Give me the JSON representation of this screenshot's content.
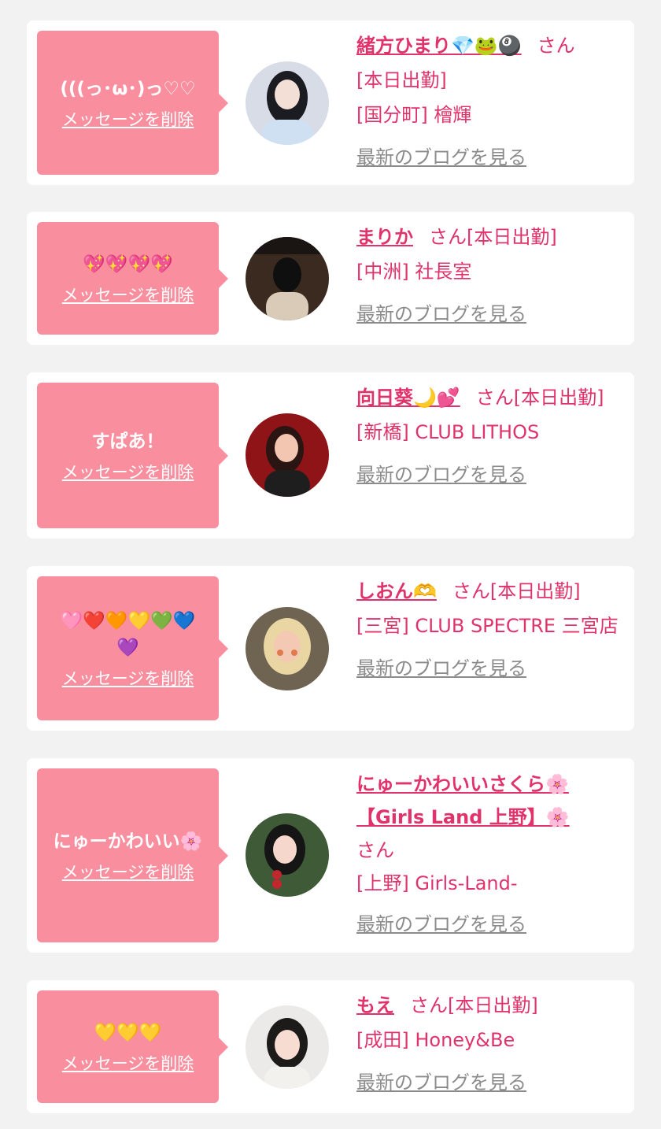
{
  "items": [
    {
      "message": "(((っ･ω･)っ♡♡",
      "delete_label": "メッセージを削除",
      "name": "緒方ひまり💎🐸🎱",
      "san": "さん",
      "status": "[本日出勤]",
      "area": "[国分町] 檜輝",
      "blog_label": "最新のブログを見る",
      "avatar_colors": [
        "#d8dce6",
        "#1b1b22",
        "#cfe0f3"
      ]
    },
    {
      "message": "💖💖💖💖",
      "delete_label": "メッセージを削除",
      "name": "まりか",
      "san": "さん",
      "status": "[本日出勤]",
      "area": "[中洲] 社長室",
      "blog_label": "最新のブログを見る",
      "avatar_colors": [
        "#3a2a20",
        "#0f0f10",
        "#d9cbb8"
      ]
    },
    {
      "message": "すぱあ！",
      "delete_label": "メッセージを削除",
      "name": "向日葵🌙💕",
      "san": "さん",
      "status": "[本日出勤]",
      "area": "[新橋] CLUB LITHOS",
      "blog_label": "最新のブログを見る",
      "avatar_colors": [
        "#8e1418",
        "#2a1512",
        "#f2c6b0"
      ]
    },
    {
      "message": "🩷❤️🧡💛💚💙\n💜",
      "delete_label": "メッセージを削除",
      "name": "しおん🫶",
      "san": "さん",
      "status": "[本日出勤]",
      "area": "[三宮] CLUB SPECTRE 三宮店",
      "blog_label": "最新のブログを見る",
      "avatar_colors": [
        "#6f6452",
        "#e9d6a3",
        "#f3c9b4"
      ]
    },
    {
      "message": "にゅーかわいい🌸",
      "delete_label": "メッセージを削除",
      "name": "にゅーかわいいさくら🌸【Girls Land 上野】🌸",
      "san": "さん",
      "status": "",
      "area": "[上野] Girls-Land-",
      "blog_label": "最新のブログを見る",
      "avatar_colors": [
        "#3f5a36",
        "#151515",
        "#f5d7cb"
      ]
    },
    {
      "message": "💛💛💛",
      "delete_label": "メッセージを削除",
      "name": "もえ",
      "san": "さん",
      "status": "[本日出勤]",
      "area": "[成田] Honey&Be",
      "blog_label": "最新のブログを見る",
      "avatar_colors": [
        "#eceae8",
        "#1d1a1a",
        "#f7dcd2"
      ]
    }
  ]
}
